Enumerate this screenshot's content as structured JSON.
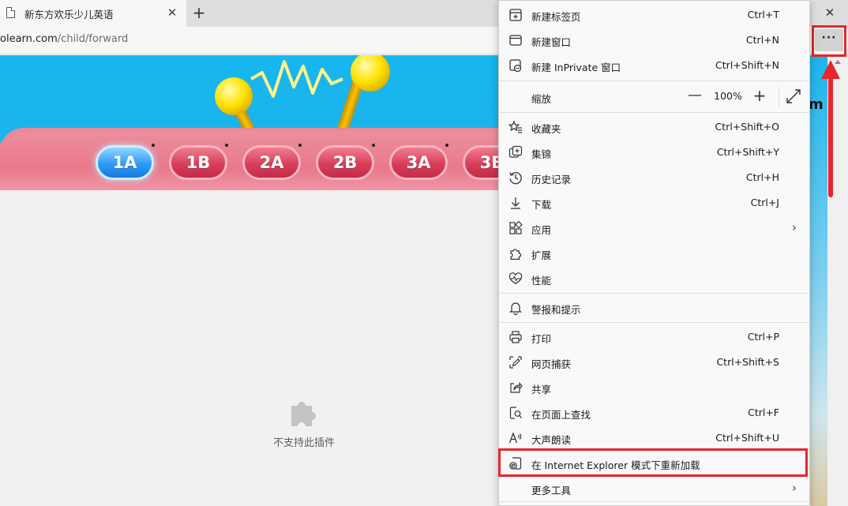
{
  "tab": {
    "title": "新东方欢乐少儿英语",
    "close": "✕"
  },
  "new_tab": "+",
  "window": {
    "close": "✕"
  },
  "address": {
    "host": "olearn.com",
    "path": "/child/forward"
  },
  "more_button": "···",
  "page": {
    "levels": [
      "1A",
      "1B",
      "2A",
      "2B",
      "3A",
      "3B"
    ],
    "active_level": "1A",
    "plugin_message": "不支持此插件",
    "partial_letter": "m"
  },
  "menu": {
    "items_top": [
      {
        "label": "新建标签页",
        "shortcut": "Ctrl+T",
        "icon": "new-tab-icon"
      },
      {
        "label": "新建窗口",
        "shortcut": "Ctrl+N",
        "icon": "new-window-icon"
      },
      {
        "label": "新建 InPrivate 窗口",
        "shortcut": "Ctrl+Shift+N",
        "icon": "inprivate-icon"
      }
    ],
    "zoom": {
      "label": "缩放",
      "minus": "—",
      "value": "100%",
      "plus": "+"
    },
    "items_mid": [
      {
        "label": "收藏夹",
        "shortcut": "Ctrl+Shift+O",
        "icon": "favorites-icon"
      },
      {
        "label": "集锦",
        "shortcut": "Ctrl+Shift+Y",
        "icon": "collections-icon"
      },
      {
        "label": "历史记录",
        "shortcut": "Ctrl+H",
        "icon": "history-icon"
      },
      {
        "label": "下载",
        "shortcut": "Ctrl+J",
        "icon": "download-icon"
      },
      {
        "label": "应用",
        "shortcut": "",
        "icon": "apps-icon",
        "submenu": true
      },
      {
        "label": "扩展",
        "shortcut": "",
        "icon": "extensions-icon"
      },
      {
        "label": "性能",
        "shortcut": "",
        "icon": "performance-icon"
      }
    ],
    "alerts": {
      "label": "警报和提示",
      "icon": "bell-icon"
    },
    "items_bottom": [
      {
        "label": "打印",
        "shortcut": "Ctrl+P",
        "icon": "print-icon"
      },
      {
        "label": "网页捕获",
        "shortcut": "Ctrl+Shift+S",
        "icon": "web-capture-icon"
      },
      {
        "label": "共享",
        "shortcut": "",
        "icon": "share-icon"
      },
      {
        "label": "在页面上查找",
        "shortcut": "Ctrl+F",
        "icon": "find-icon"
      },
      {
        "label": "大声朗读",
        "shortcut": "Ctrl+Shift+U",
        "icon": "read-aloud-icon"
      },
      {
        "label": "在 Internet Explorer 模式下重新加载",
        "shortcut": "",
        "icon": "ie-mode-icon"
      },
      {
        "label": "更多工具",
        "shortcut": "",
        "icon": "more-tools-icon",
        "submenu": true
      }
    ],
    "chevron": "›"
  },
  "colors": {
    "highlight": "#e8262d",
    "sky": "#16b6ee",
    "pill_active": "#2f9bf5",
    "pill": "#d83e5a"
  }
}
